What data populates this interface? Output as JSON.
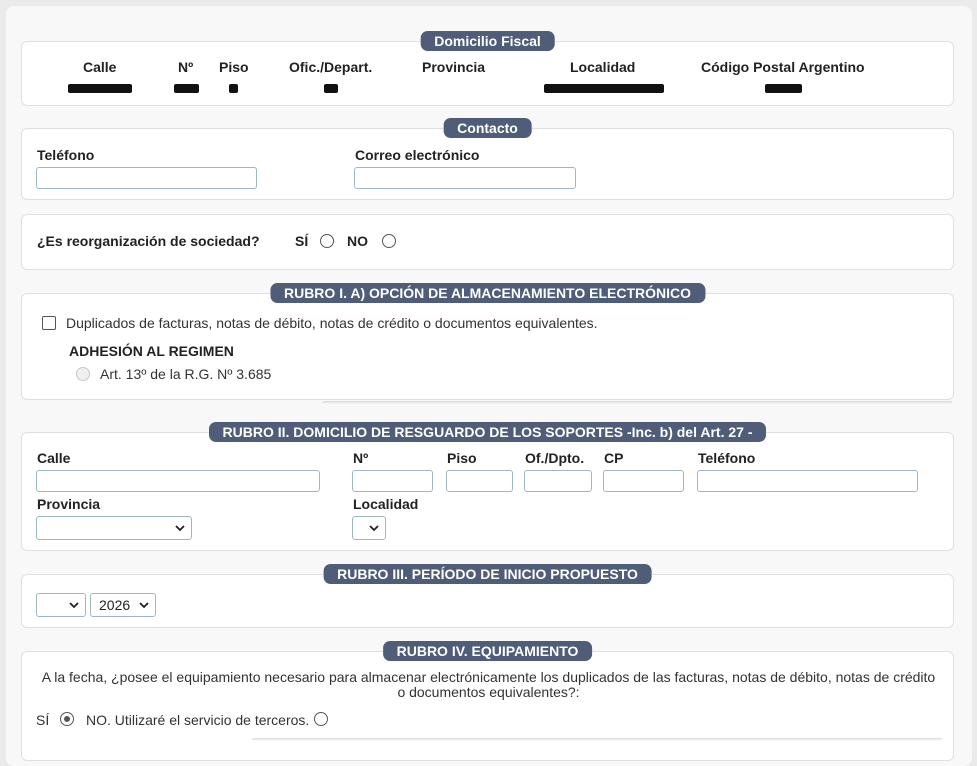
{
  "domicilio_fiscal": {
    "legend": "Domicilio Fiscal",
    "cols": [
      "Calle",
      "Nº",
      "Piso",
      "Ofic./Depart.",
      "Provincia",
      "Localidad",
      "Código Postal Argentino"
    ]
  },
  "contacto": {
    "legend": "Contacto",
    "telefono_label": "Teléfono",
    "telefono_value": "",
    "correo_label": "Correo electrónico",
    "correo_value": ""
  },
  "reorganizacion": {
    "question": "¿Es reorganización de sociedad?",
    "si_label": "SÍ",
    "no_label": "NO"
  },
  "rubro1": {
    "legend": "RUBRO I. A) OPCIÓN DE ALMACENAMIENTO ELECTRÓNICO",
    "checkbox_label": "Duplicados de facturas, notas de débito, notas de crédito o documentos equivalentes.",
    "adhesion_title": "ADHESIÓN AL REGIMEN",
    "adhesion_option": "Art. 13º de la R.G. Nº 3.685"
  },
  "rubro2": {
    "legend": "RUBRO II. DOMICILIO DE RESGUARDO DE LOS SOPORTES -Inc. b) del Art. 27 -",
    "calle_label": "Calle",
    "nro_label": "Nº",
    "piso_label": "Piso",
    "ofdpto_label": "Of./Dpto.",
    "cp_label": "CP",
    "telefono_label": "Teléfono",
    "provincia_label": "Provincia",
    "provincia_value": "",
    "localidad_label": "Localidad",
    "localidad_value": ""
  },
  "rubro3": {
    "legend": "RUBRO III. PERÍODO DE INICIO PROPUESTO",
    "month_value": "",
    "year_value": "2026"
  },
  "rubro4": {
    "legend": "RUBRO IV. EQUIPAMIENTO",
    "question": "A la fecha, ¿posee el equipamiento necesario para almacenar electrónicamente los duplicados de las facturas, notas de débito, notas de crédito o documentos equivalentes?:",
    "si_label": "SÍ",
    "no_label": "NO. Utilizaré el servicio de terceros.",
    "selected": "si"
  }
}
